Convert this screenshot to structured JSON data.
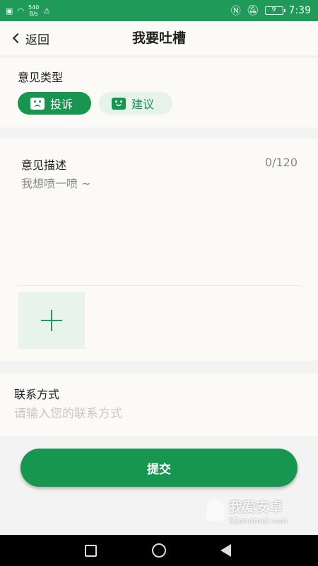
{
  "status_bar": {
    "net_speed_value": "540",
    "net_speed_unit": "B/s",
    "battery": "9",
    "time": "7:39"
  },
  "header": {
    "back_label": "返回",
    "title": "我要吐槽"
  },
  "feedback_type": {
    "label": "意见类型",
    "options": [
      {
        "label": "投诉",
        "selected": true
      },
      {
        "label": "建议",
        "selected": false
      }
    ]
  },
  "description": {
    "label": "意见描述",
    "counter": "0/120",
    "placeholder": "我想喷一喷 ~",
    "value": ""
  },
  "contact": {
    "label": "联系方式",
    "placeholder": "请输入您的联系方式",
    "value": ""
  },
  "submit_label": "提交",
  "watermark": {
    "text": "我爱安卓",
    "url": "52android.com"
  },
  "colors": {
    "accent": "#16964f",
    "accent_light": "#e6f3eb",
    "statusbar": "#1f9a58"
  }
}
